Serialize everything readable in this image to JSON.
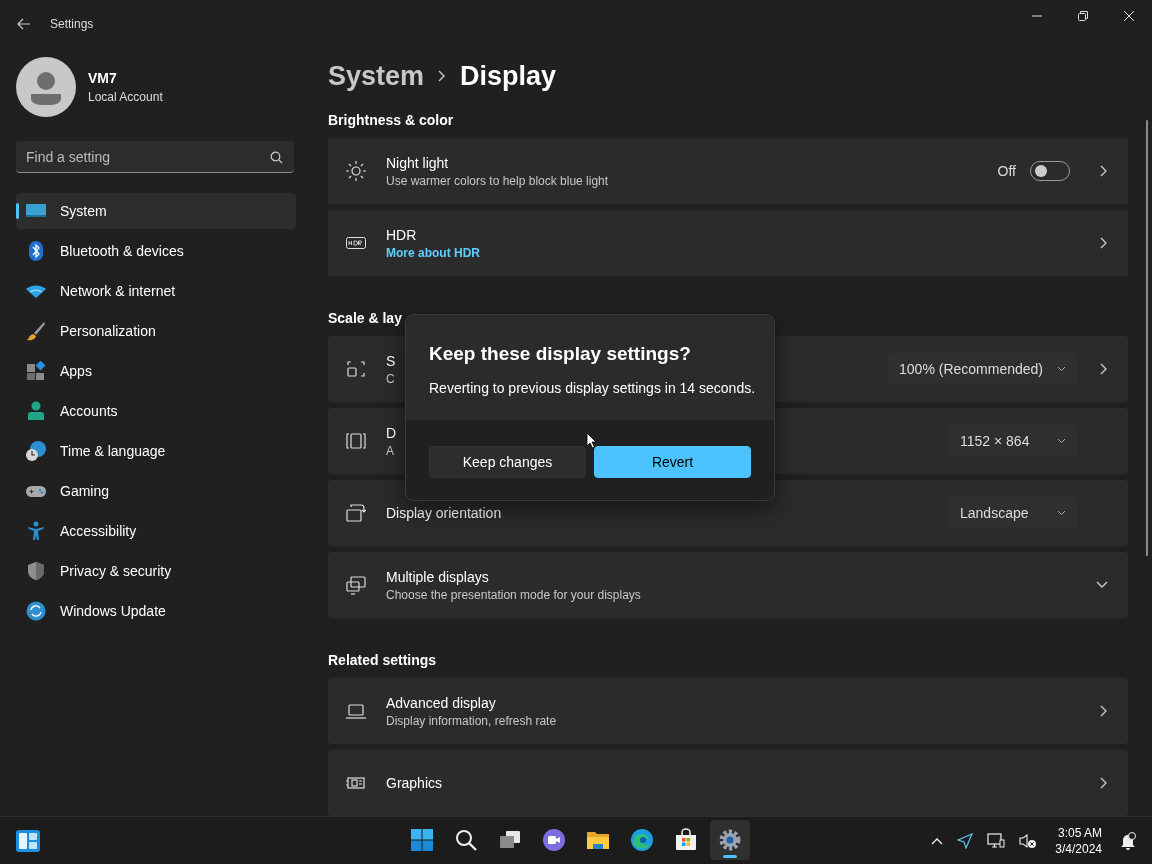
{
  "window": {
    "title": "Settings"
  },
  "account": {
    "name": "VM7",
    "type": "Local Account"
  },
  "search": {
    "placeholder": "Find a setting"
  },
  "nav": [
    {
      "label": "System",
      "selected": true
    },
    {
      "label": "Bluetooth & devices",
      "selected": false
    },
    {
      "label": "Network & internet",
      "selected": false
    },
    {
      "label": "Personalization",
      "selected": false
    },
    {
      "label": "Apps",
      "selected": false
    },
    {
      "label": "Accounts",
      "selected": false
    },
    {
      "label": "Time & language",
      "selected": false
    },
    {
      "label": "Gaming",
      "selected": false
    },
    {
      "label": "Accessibility",
      "selected": false
    },
    {
      "label": "Privacy & security",
      "selected": false
    },
    {
      "label": "Windows Update",
      "selected": false
    }
  ],
  "breadcrumb": {
    "parent": "System",
    "current": "Display"
  },
  "sections": [
    {
      "title": "Brightness & color",
      "rows": [
        {
          "kind": "toggle",
          "title": "Night light",
          "subtitle": "Use warmer colors to help block blue light",
          "state_label": "Off",
          "on": false
        },
        {
          "kind": "nav",
          "title": "HDR",
          "link": "More about HDR"
        }
      ]
    },
    {
      "title": "Scale & lay",
      "rows": [
        {
          "kind": "dropdown",
          "title": "S",
          "subtitle": "C",
          "value": "100% (Recommended)",
          "navigable": true
        },
        {
          "kind": "dropdown",
          "title": "D",
          "subtitle": "A",
          "value": "1152 × 864",
          "navigable": false
        },
        {
          "kind": "dropdown",
          "title": "Display orientation",
          "value": "Landscape",
          "navigable": false
        },
        {
          "kind": "expander",
          "title": "Multiple displays",
          "subtitle": "Choose the presentation mode for your displays",
          "expanded": false
        }
      ]
    },
    {
      "title": "Related settings",
      "rows": [
        {
          "kind": "nav",
          "title": "Advanced display",
          "subtitle": "Display information, refresh rate"
        },
        {
          "kind": "nav",
          "title": "Graphics"
        }
      ]
    }
  ],
  "dialog": {
    "title": "Keep these display settings?",
    "message": "Reverting to previous display settings in 14 seconds.",
    "buttons": [
      {
        "label": "Keep changes",
        "primary": false
      },
      {
        "label": "Revert",
        "primary": true
      }
    ]
  },
  "taskbar": {
    "apps": [
      {
        "selected": false
      },
      {
        "selected": false
      },
      {
        "selected": false
      },
      {
        "selected": false
      },
      {
        "selected": false
      },
      {
        "selected": false
      },
      {
        "selected": false
      },
      {
        "selected": true
      }
    ],
    "time": "3:05 AM",
    "date": "3/4/2024"
  }
}
